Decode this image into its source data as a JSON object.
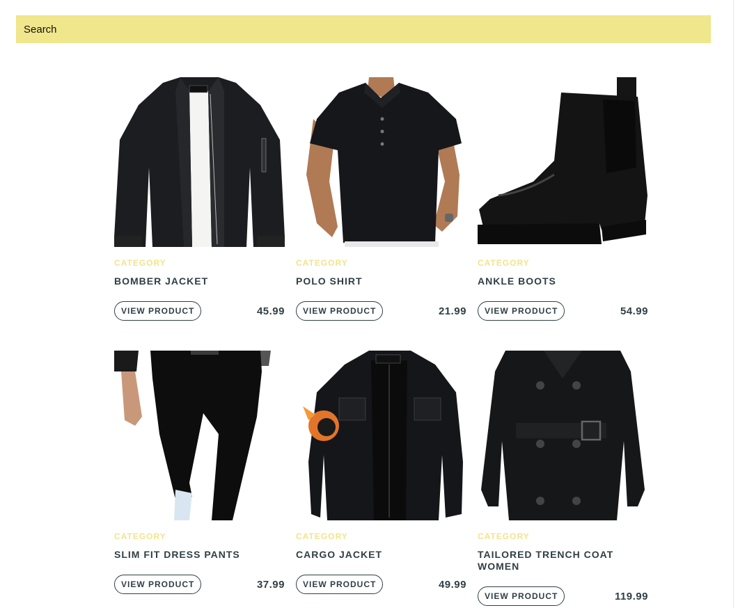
{
  "search": {
    "label": "Search"
  },
  "products": [
    {
      "category": "Category",
      "name": "Bomber Jacket",
      "button": "View Product",
      "price": "45.99",
      "icon": "bomber-jacket-image"
    },
    {
      "category": "Category",
      "name": "Polo Shirt",
      "button": "View Product",
      "price": "21.99",
      "icon": "polo-shirt-image"
    },
    {
      "category": "Category",
      "name": "Ankle Boots",
      "button": "View Product",
      "price": "54.99",
      "icon": "ankle-boots-image"
    },
    {
      "category": "Category",
      "name": "Slim Fit Dress Pants",
      "button": "View Product",
      "price": "37.99",
      "icon": "dress-pants-image"
    },
    {
      "category": "Category",
      "name": "Cargo Jacket",
      "button": "View Product",
      "price": "49.99",
      "icon": "cargo-jacket-image"
    },
    {
      "category": "Category",
      "name": "Tailored Trench Coat Women",
      "button": "View Product",
      "price": "119.99",
      "icon": "trench-coat-image"
    }
  ],
  "colors": {
    "search_bg": "#f0e68c",
    "category_text": "#f1e48c",
    "text_dark": "#2f3f45"
  }
}
